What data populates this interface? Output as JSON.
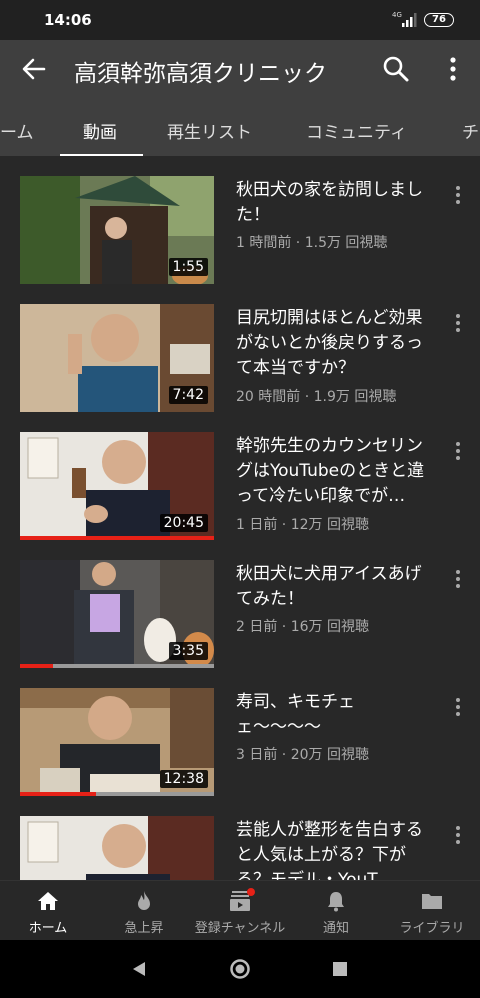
{
  "status": {
    "time": "14:06",
    "network": "4G",
    "battery": "76"
  },
  "appbar": {
    "title": "高須幹弥高須クリニック"
  },
  "tabs": [
    {
      "label": "ーム"
    },
    {
      "label": "動画"
    },
    {
      "label": "再生リスト"
    },
    {
      "label": "コミュニティ"
    },
    {
      "label": "チ"
    }
  ],
  "videos": [
    {
      "title": "秋田犬の家を訪問しました！",
      "meta": "1 時間前 · 1.5万 回視聴",
      "duration": "1:55",
      "progress": 0
    },
    {
      "title": "目尻切開はほとんど効果がないとか後戻りするって本当ですか？",
      "meta": "20 時間前 · 1.9万 回視聴",
      "duration": "7:42",
      "progress": 0
    },
    {
      "title": "幹弥先生のカウンセリングはYouTubeのときと違って冷たい印象でが…",
      "meta": "1 日前 · 12万 回視聴",
      "duration": "20:45",
      "progress": 1.0
    },
    {
      "title": "秋田犬に犬用アイスあげてみた！",
      "meta": "2 日前 · 16万 回視聴",
      "duration": "3:35",
      "progress": 0.17
    },
    {
      "title": "寿司、キモチェェ〜〜〜〜",
      "meta": "3 日前 · 20万 回視聴",
      "duration": "12:38",
      "progress": 0.39
    },
    {
      "title": "芸能人が整形を告白すると人気は上がる？下がる？モデル・YouT",
      "meta": "",
      "duration": "",
      "progress": 0
    }
  ],
  "bottom_nav": [
    {
      "label": "ホーム",
      "icon": "home-icon"
    },
    {
      "label": "急上昇",
      "icon": "flame-icon"
    },
    {
      "label": "登録チャンネル",
      "icon": "subscriptions-icon"
    },
    {
      "label": "通知",
      "icon": "bell-icon"
    },
    {
      "label": "ライブラリ",
      "icon": "folder-icon"
    }
  ],
  "colors": {
    "accent": "#e62117",
    "bar": "#3f3f3f",
    "bg": "#282828"
  }
}
